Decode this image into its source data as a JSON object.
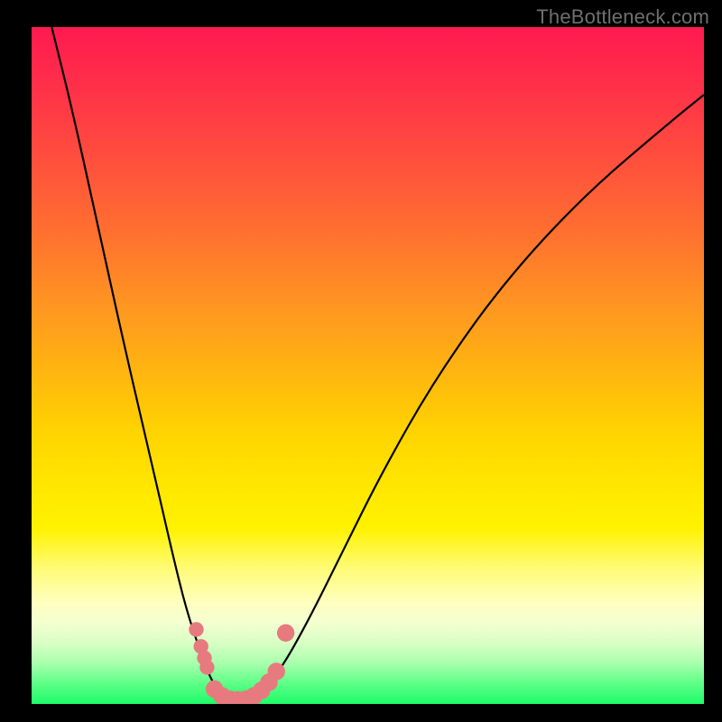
{
  "watermark": {
    "text": "TheBottleneck.com"
  },
  "chart_data": {
    "type": "line",
    "title": "",
    "xlabel": "",
    "ylabel": "",
    "xlim": [
      0,
      100
    ],
    "ylim": [
      0,
      100
    ],
    "grid": false,
    "legend": false,
    "background_gradient": {
      "top": "#ff1a4f",
      "mid": "#ffe700",
      "bottom": "#1efb69"
    },
    "series": [
      {
        "name": "bottleneck-curve",
        "x": [
          3,
          6,
          10,
          14,
          18,
          21,
          23,
          25,
          26.5,
          28,
          30,
          32,
          34,
          37,
          41,
          46,
          52,
          60,
          70,
          82,
          95,
          100
        ],
        "y": [
          100,
          88,
          70,
          52,
          35,
          22,
          14,
          8,
          4,
          1.5,
          0.5,
          0.5,
          1.5,
          5,
          12,
          22,
          34,
          48,
          62,
          75,
          86,
          90
        ]
      }
    ],
    "markers": [
      {
        "name": "left-cluster-1",
        "x": 24.5,
        "y": 11,
        "r": 1.1
      },
      {
        "name": "left-cluster-2",
        "x": 25.2,
        "y": 8.5,
        "r": 1.1
      },
      {
        "name": "left-cluster-3",
        "x": 25.7,
        "y": 6.8,
        "r": 1.1
      },
      {
        "name": "left-cluster-4",
        "x": 26.1,
        "y": 5.4,
        "r": 1.1
      },
      {
        "name": "valley-1",
        "x": 27.2,
        "y": 2.2,
        "r": 1.3
      },
      {
        "name": "valley-2",
        "x": 28.3,
        "y": 1.2,
        "r": 1.3
      },
      {
        "name": "valley-3",
        "x": 29.5,
        "y": 0.7,
        "r": 1.3
      },
      {
        "name": "valley-4",
        "x": 30.7,
        "y": 0.6,
        "r": 1.3
      },
      {
        "name": "valley-5",
        "x": 31.9,
        "y": 0.7,
        "r": 1.3
      },
      {
        "name": "valley-6",
        "x": 33.1,
        "y": 1.2,
        "r": 1.3
      },
      {
        "name": "valley-7",
        "x": 34.2,
        "y": 2.0,
        "r": 1.3
      },
      {
        "name": "right-rise-1",
        "x": 35.3,
        "y": 3.2,
        "r": 1.3
      },
      {
        "name": "right-rise-2",
        "x": 36.4,
        "y": 4.8,
        "r": 1.3
      },
      {
        "name": "right-outlier",
        "x": 37.8,
        "y": 10.5,
        "r": 1.3
      }
    ],
    "marker_color": "#e77a7f",
    "curve_color": "#000000"
  }
}
